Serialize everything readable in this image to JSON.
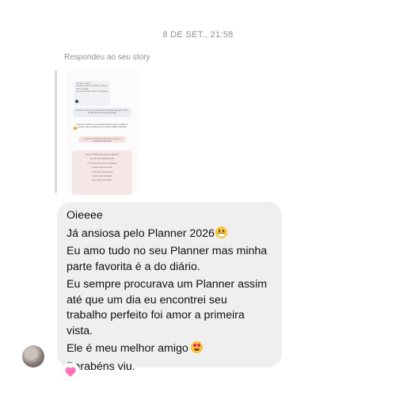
{
  "thread": {
    "timestamp": "8 DE SET., 21:58",
    "reply_label": "Respondeu ao seu story"
  },
  "story_preview": {
    "qa_lines": [
      "Oii, Bom tarde!",
      "A minha caneca do 2026 é para planner??",
      "E tem versão",
      "Vou chamar de vocês no dia 3 para a data"
    ],
    "wide_card_text": "É preciso criar um cronograma de tarefas. Aguarde prazo: 14 dias já mínimo para planejar.",
    "price_card_text": "O planner 2026 tem preço 2026! Vai! O planner 2026 é a versão mais completa com a minha criação integrada",
    "pill_text": "O planner é inclusivo todo ano e a dor ao sentimento da leitura",
    "pink_card_lines": [
      "Planner 2026 ajuda você a organizar",
      "seu ano em planejamento",
      "e no dia a dia, para acompanhar",
      "e para estar com você.",
      "A cada ano planejamos",
      "ainda mais conteúdo",
      "para você e seu diário."
    ]
  },
  "message": {
    "lines": [
      "Oieeee",
      "Já ansiosa pelo Planner 2026",
      "Eu amo tudo no seu Planner mas minha",
      "parte favorita é a do diário.",
      "Eu sempre procurava um Planner assim",
      "até que um dia eu encontrei seu",
      "trabalho perfeito foi amor a primeira",
      "vista.",
      "Ele é meu melhor amigo",
      "Parabéns viu."
    ],
    "emoji_1": "grinning-face",
    "emoji_2": "heart-eyes-face"
  },
  "reaction": {
    "icon": "pink-heart-icon",
    "color": "#ff6fb5"
  },
  "colors": {
    "bubble_bg": "#efefef",
    "meta_text": "#8e8e8e"
  }
}
